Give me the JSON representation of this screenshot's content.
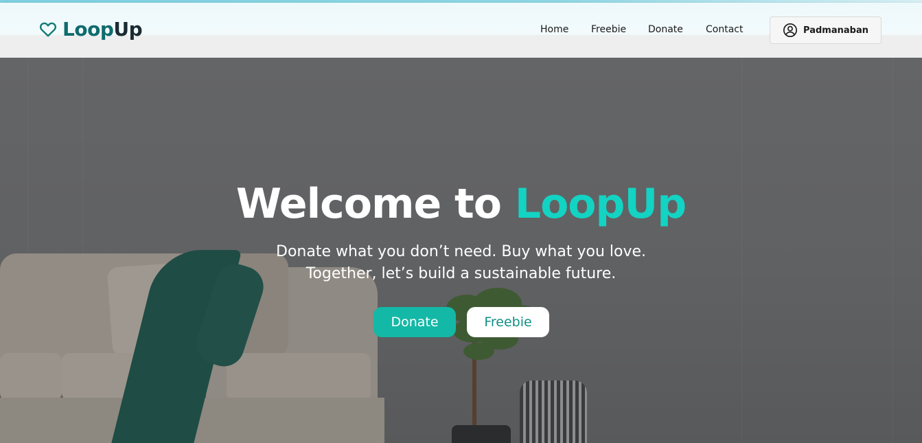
{
  "brand": {
    "name_part1": "Loop",
    "name_part2": "Up",
    "icon": "heart-icon",
    "colors": {
      "primary": "#0f6b6e",
      "dark": "#1b2b33",
      "accent": "#13d3c3",
      "button": "#14b8a6"
    }
  },
  "nav": {
    "items": [
      {
        "label": "Home"
      },
      {
        "label": "Freebie"
      },
      {
        "label": "Donate"
      },
      {
        "label": "Contact"
      }
    ]
  },
  "user": {
    "name": "Padmanaban",
    "icon": "user-circle-icon"
  },
  "hero": {
    "title_prefix": "Welcome to ",
    "title_accent": "LoopUp",
    "subtitle_line1": "Donate what you don’t need. Buy what you love.",
    "subtitle_line2": "Together, let’s build a sustainable future.",
    "primary_button": "Donate",
    "secondary_button": "Freebie"
  }
}
